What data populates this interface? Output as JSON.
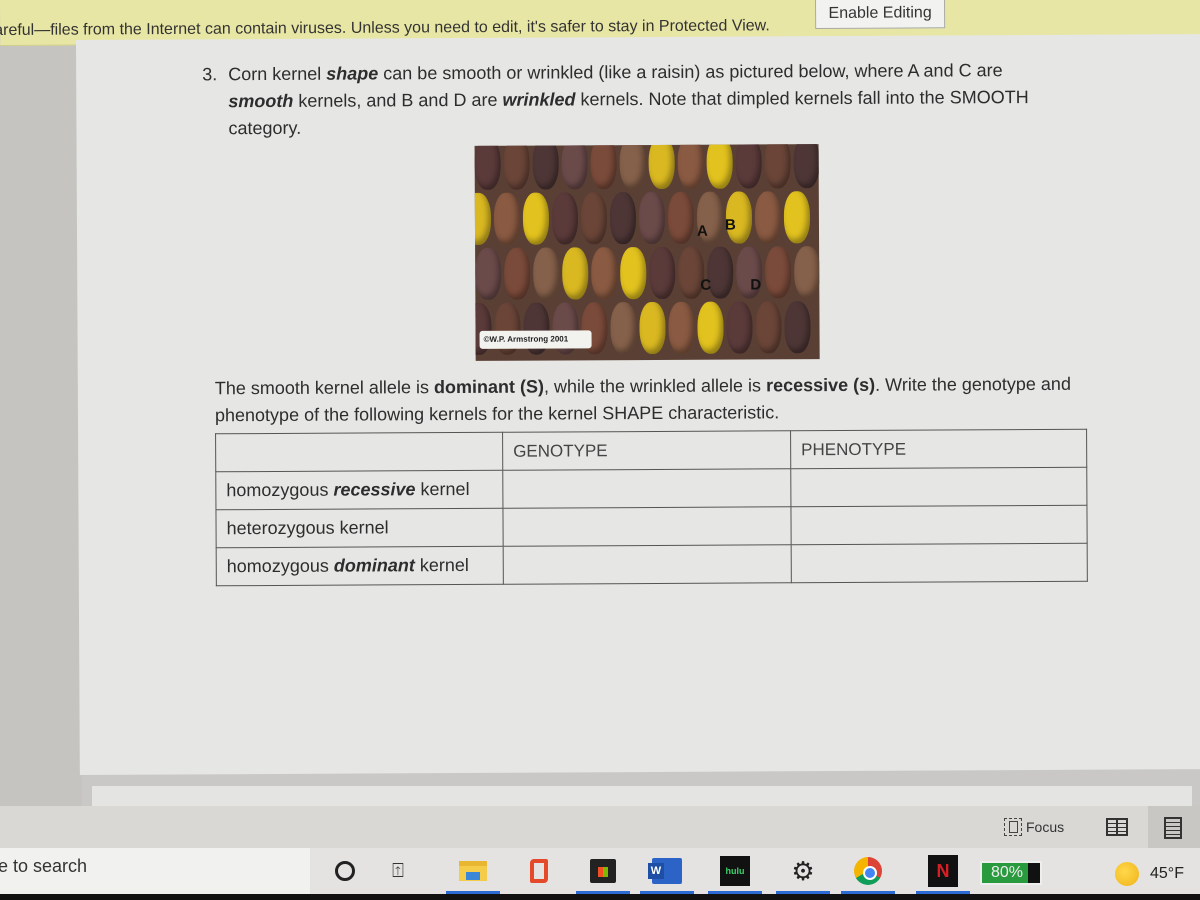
{
  "protected_view": {
    "message": "areful—files from the Internet can contain viruses. Unless you need to edit, it's safer to stay in Protected View.",
    "enable_button": "Enable Editing",
    "bar_color": "#e8e6a4"
  },
  "question": {
    "number": "3.",
    "line1_a": "Corn kernel ",
    "line1_b": "shape",
    "line1_c": " can be smooth or wrinkled (like a raisin) as pictured below, where A and C are",
    "line2_a": "smooth",
    "line2_b": " kernels, and B and D are ",
    "line2_c": "wrinkled",
    "line2_d": " kernels.  Note that dimpled kernels fall into the SMOOTH",
    "line3": "category."
  },
  "photo": {
    "labels": [
      "A",
      "B",
      "C",
      "D"
    ],
    "credit": "©W.P. Armstrong 2001"
  },
  "instructions": {
    "p1": "The smooth kernel allele is ",
    "p1_bold": "dominant (S)",
    "p2": ", while the wrinkled allele is ",
    "p2_bold": "recessive (s)",
    "p3": ".  Write the genotype and phenotype of the following kernels for the kernel SHAPE characteristic."
  },
  "table": {
    "headers": [
      "",
      "GENOTYPE",
      "PHENOTYPE"
    ],
    "rows": [
      {
        "pre": "homozygous ",
        "emph": "recessive",
        "post": " kernel",
        "genotype": "",
        "phenotype": ""
      },
      {
        "pre": "heterozygous kernel",
        "emph": "",
        "post": "",
        "genotype": "",
        "phenotype": ""
      },
      {
        "pre": "homozygous ",
        "emph": "dominant",
        "post": " kernel",
        "genotype": "",
        "phenotype": ""
      }
    ]
  },
  "status_bar": {
    "focus_label": "Focus"
  },
  "taskbar": {
    "search_text": "e to search",
    "battery_percent": 80,
    "battery_label": "80%",
    "temperature": "45°F",
    "hulu_label": "hulu",
    "word_label": "W",
    "netflix_label": "N",
    "taskview_glyph": "⍐"
  }
}
